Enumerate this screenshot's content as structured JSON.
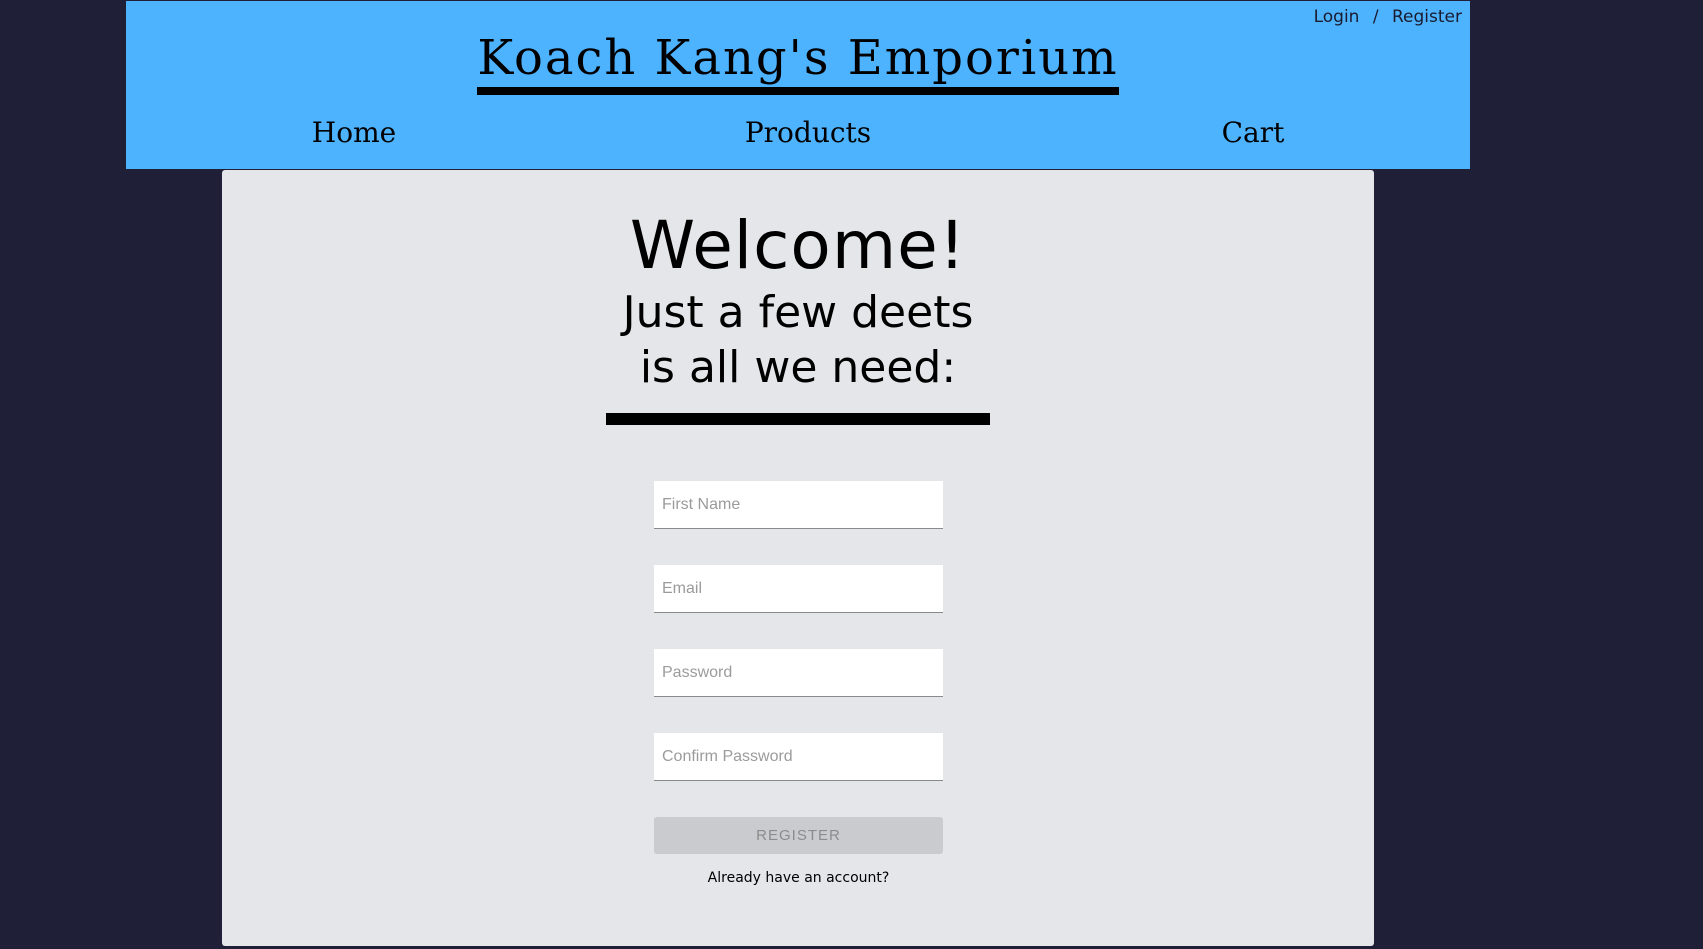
{
  "header": {
    "title": "Koach Kang's Emporium",
    "auth": {
      "login": "Login",
      "separator": "/",
      "register": "Register"
    },
    "nav": [
      {
        "label": "Home"
      },
      {
        "label": "Products"
      },
      {
        "label": "Cart"
      }
    ],
    "background_color": "#4db3ff"
  },
  "page": {
    "background_color": "#1f1f38",
    "panel_color": "#e5e6ea"
  },
  "welcome": {
    "title": "Welcome!",
    "subtitle_line1": "Just a few deets",
    "subtitle_line2": "is all we need:"
  },
  "form": {
    "first_name": {
      "placeholder": "First Name",
      "value": ""
    },
    "email": {
      "placeholder": "Email",
      "value": ""
    },
    "password": {
      "placeholder": "Password",
      "value": ""
    },
    "confirm_password": {
      "placeholder": "Confirm Password",
      "value": ""
    },
    "submit_label": "REGISTER",
    "account_link": "Already have an account?"
  }
}
